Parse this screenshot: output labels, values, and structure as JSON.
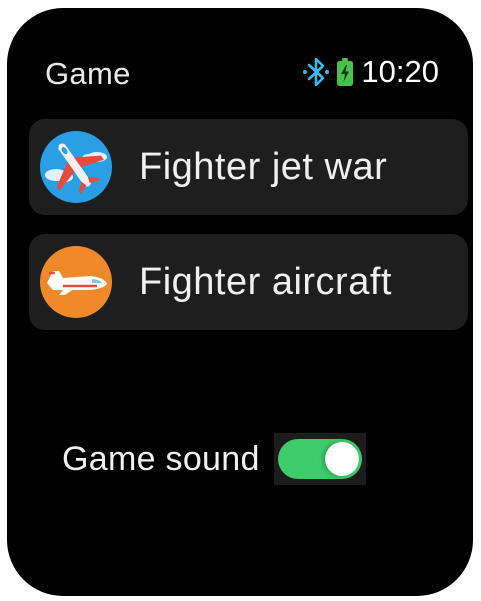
{
  "header": {
    "title": "Game",
    "time": "10:20",
    "bluetooth_icon": "bluetooth-icon",
    "battery_icon": "battery-charging-icon"
  },
  "games": [
    {
      "label": "Fighter jet war",
      "icon": "fighter-jet-war-icon"
    },
    {
      "label": "Fighter aircraft",
      "icon": "fighter-aircraft-icon"
    }
  ],
  "settings": {
    "game_sound_label": "Game sound",
    "game_sound_enabled": true
  },
  "colors": {
    "background": "#000000",
    "list_item_bg": "#1e1e1e",
    "toggle_on": "#3ccc6a",
    "bluetooth": "#3fb7e8",
    "battery": "#49c14a",
    "jet_icon_bg": "#2a9fe6",
    "aircraft_icon_bg": "#ef8a2a"
  }
}
